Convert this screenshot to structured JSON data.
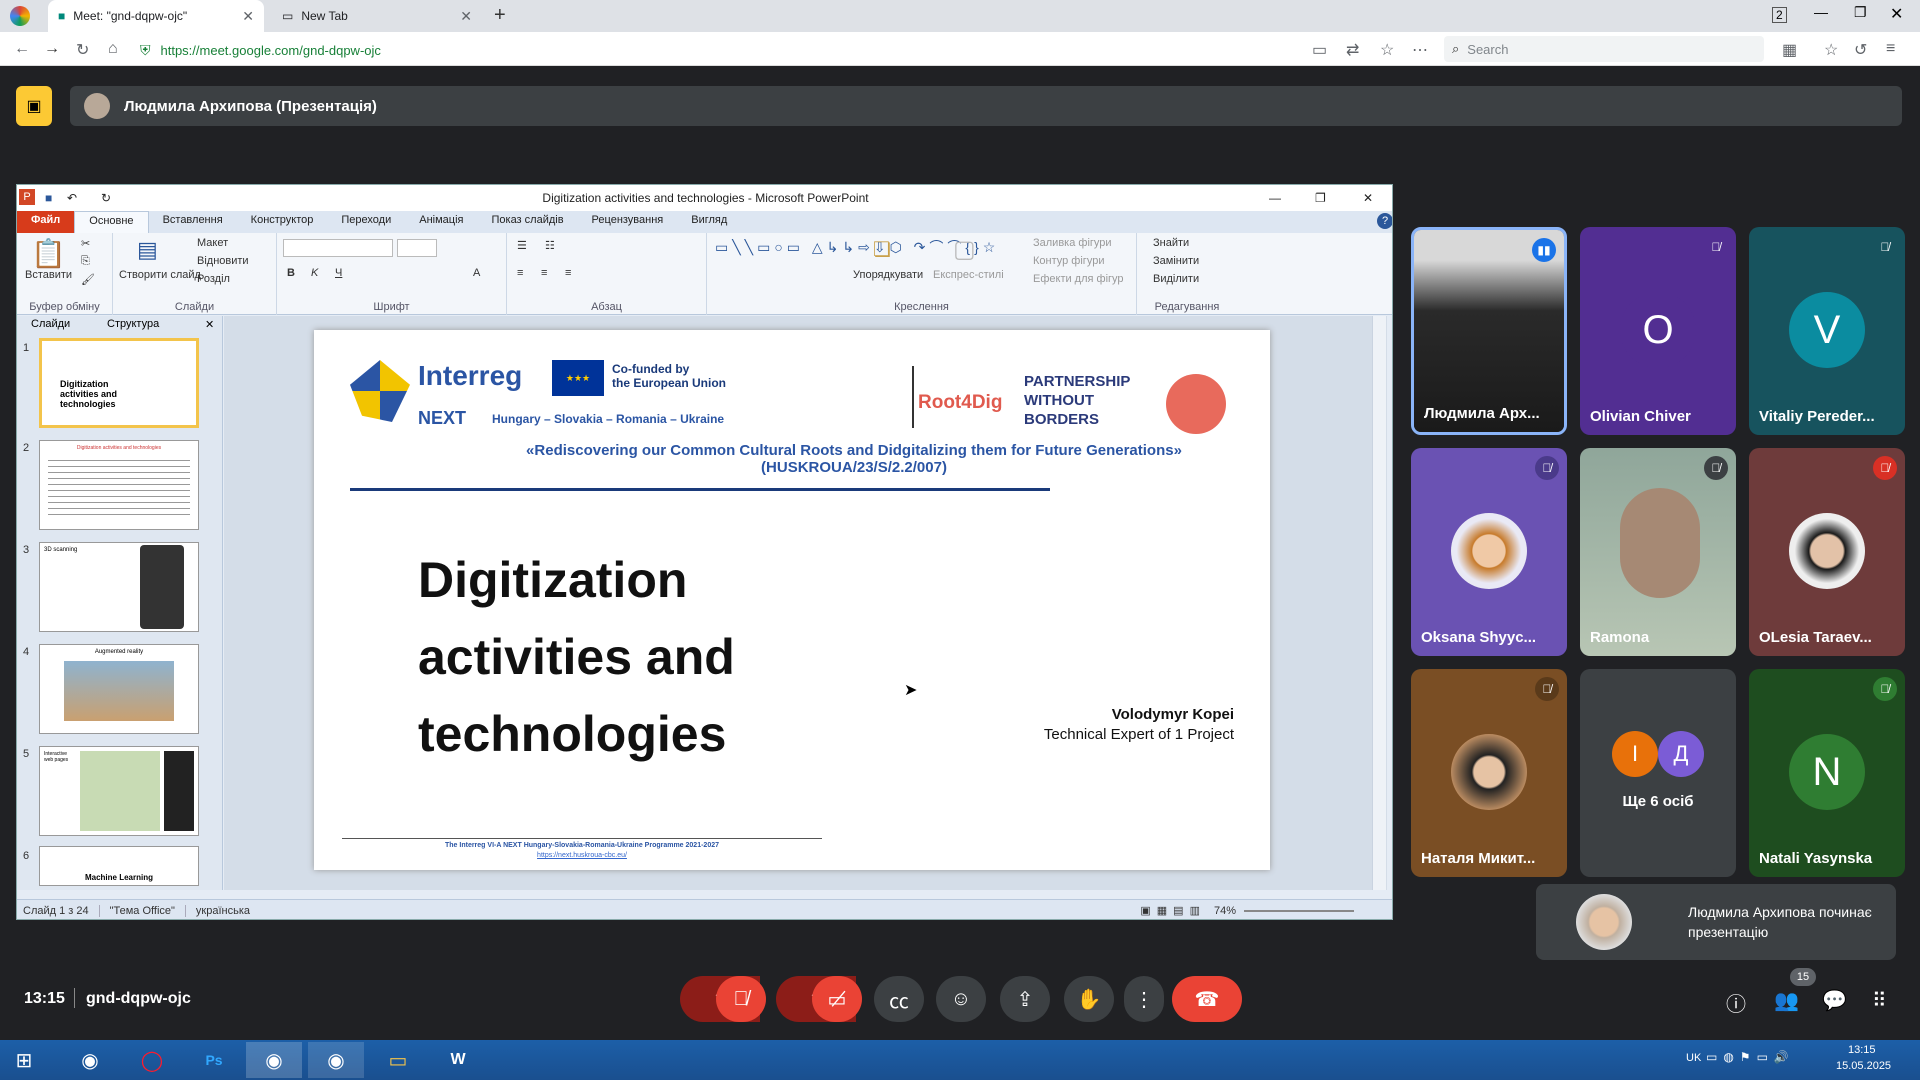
{
  "browser": {
    "tabs": [
      {
        "label": "Meet: \"gnd-dqpw-ojc\"",
        "active": true
      },
      {
        "label": "New Tab",
        "active": false
      }
    ],
    "new_tab": "+",
    "url": "https://meet.google.com/gnd-dqpw-ojc",
    "search_placeholder": "Search"
  },
  "meet": {
    "presenter_banner": "Людмила Архипова (Презентація)",
    "meeting_time": "13:15",
    "meeting_code": "gnd-dqpw-ojc",
    "participants_count": "15",
    "notification": "Людмила Архипова починає презентацію",
    "more_people": "Ще 6 осіб",
    "more_initials": [
      "І",
      "Д"
    ],
    "participants": [
      {
        "name": "Людмила Арх...",
        "letter": "",
        "color": "#3a3a3a"
      },
      {
        "name": "Olivian Chiver",
        "letter": "O",
        "color": "#7b3fbf"
      },
      {
        "name": "Vitaliy Pereder...",
        "letter": "V",
        "color": "#0b8ca0"
      },
      {
        "name": "Oksana Shyyc...",
        "letter": "",
        "color": "#6a52b3"
      },
      {
        "name": "Ramona",
        "letter": "",
        "color": "#8fa69a"
      },
      {
        "name": "OLesia Taraev...",
        "letter": "",
        "color": "#6e3b3b"
      },
      {
        "name": "Наталя Микит...",
        "letter": "",
        "color": "#7a4e24"
      },
      {
        "name": "Natali Yasynska",
        "letter": "N",
        "color": "#2f7d32"
      }
    ]
  },
  "ppt": {
    "window_title": "Digitization activities and technologies - Microsoft PowerPoint",
    "tabs": [
      "Файл",
      "Основне",
      "Вставлення",
      "Конструктор",
      "Переходи",
      "Анімація",
      "Показ слайдів",
      "Рецензування",
      "Вигляд"
    ],
    "groups": [
      "Буфер обміну",
      "Слайди",
      "Шрифт",
      "Абзац",
      "Креслення",
      "Редагування"
    ],
    "buttons": {
      "paste": "Вставити",
      "layout": "Макет",
      "reset": "Відновити",
      "section": "Розділ",
      "new_slide": "Створити слайд",
      "arrange": "Упорядкувати",
      "quick_styles": "Експрес-стилі",
      "shape_fill": "Заливка фігури",
      "shape_outline": "Контур фігури",
      "shape_effects": "Ефекти для фігур",
      "find": "Знайти",
      "replace": "Замінити",
      "select": "Виділити"
    },
    "pane_tabs": [
      "Слайди",
      "Структура"
    ],
    "thumbnails": [
      {
        "num": "1",
        "text": "Digitization activities and technologies"
      },
      {
        "num": "2",
        "text": "Digitization activities and technologies"
      },
      {
        "num": "3",
        "text": "3D scanning"
      },
      {
        "num": "4",
        "text": "Augmented reality"
      },
      {
        "num": "5",
        "text": "Interactive web pages"
      },
      {
        "num": "6",
        "text": "Machine Learning"
      }
    ],
    "status": {
      "slide": "Слайд 1 з 24",
      "theme": "\"Тема Office\"",
      "lang": "українська",
      "zoom": "74%"
    },
    "slide": {
      "interreg": "Interreg",
      "cofunded": "Co-funded by\nthe European Union",
      "next": "NEXT",
      "countries": "Hungary – Slovakia – Romania – Ukraine",
      "root4dig": "Root4Dig",
      "partnership": "PARTNERSHIP\nWITHOUT\nBORDERS",
      "subtitle": "«Rediscovering our Common Cultural Roots and Didgitalizing them for Future Generations» (HUSKROUA/23/S/2.2/007)",
      "title": "Digitization\nactivities and\ntechnologies",
      "author": "Volodymyr Kopei",
      "role": "Technical Expert of 1 Project",
      "footer": "The Interreg VI-A NEXT Hungary-Slovakia-Romania-Ukraine Programme 2021-2027",
      "footer_url": "https://next.huskroua-cbc.eu/"
    }
  },
  "taskbar": {
    "lang": "UK",
    "time": "13:15",
    "date": "15.05.2025"
  }
}
